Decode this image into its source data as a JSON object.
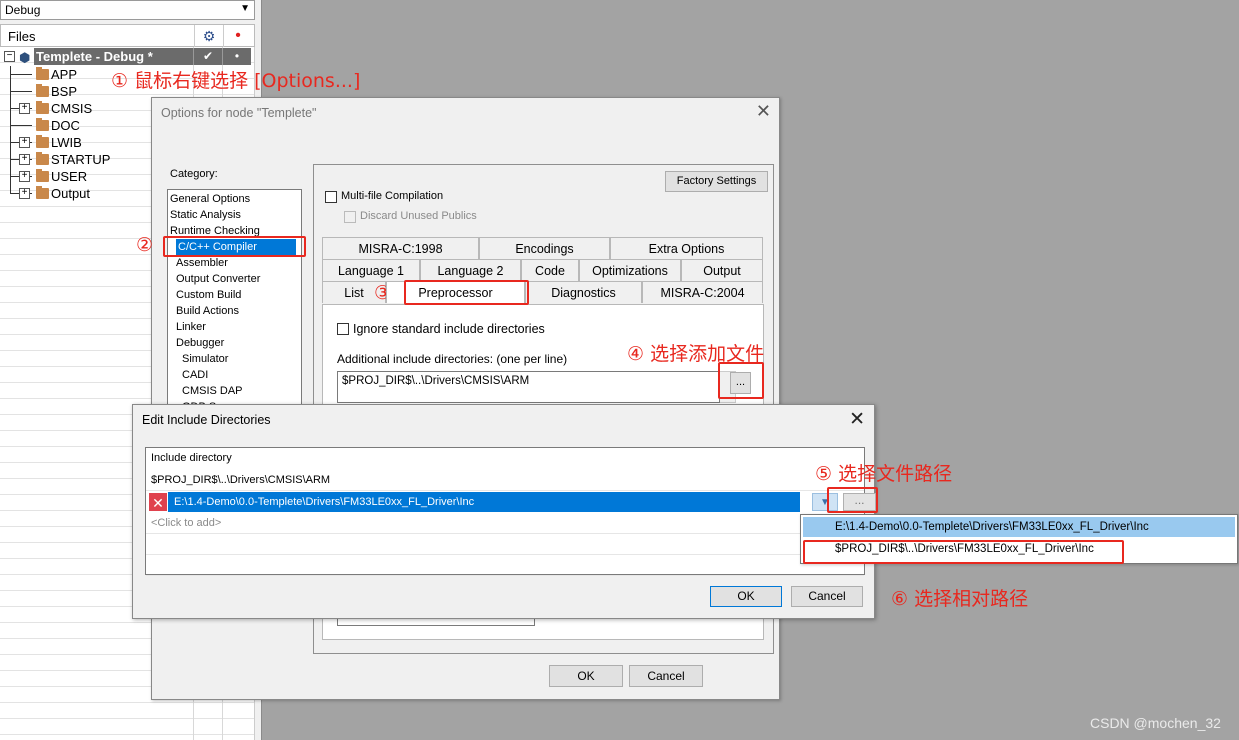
{
  "workspace": {
    "config": "Debug",
    "files_label": "Files",
    "root": "Templete - Debug *",
    "root_check": "✔",
    "root_dot": "•",
    "items": [
      {
        "label": "APP",
        "expandable": false
      },
      {
        "label": "BSP",
        "expandable": false
      },
      {
        "label": "CMSIS",
        "expandable": true
      },
      {
        "label": "DOC",
        "expandable": false
      },
      {
        "label": "LWIB",
        "expandable": true
      },
      {
        "label": "STARTUP",
        "expandable": true
      },
      {
        "label": "USER",
        "expandable": true
      },
      {
        "label": "Output",
        "expandable": true
      }
    ],
    "expand_glyph": "+",
    "collapse_glyph": "−"
  },
  "annotations": {
    "a1": "① 鼠标右键选择 [Options...]",
    "a2": "②",
    "a3": "③",
    "a4": "④ 选择添加文件",
    "a5": "⑤ 选择文件路径",
    "a6": "⑥ 选择相对路径"
  },
  "options_dialog": {
    "title": "Options for node \"Templete\"",
    "close": "✕",
    "category_label": "Category:",
    "categories": [
      "General Options",
      "Static Analysis",
      "Runtime Checking",
      "C/C++ Compiler",
      "Assembler",
      "Output Converter",
      "Custom Build",
      "Build Actions",
      "Linker",
      "Debugger",
      "Simulator",
      "CADI",
      "CMSIS DAP",
      "GDB Server"
    ],
    "selected_category": "C/C++ Compiler",
    "factory_settings": "Factory Settings",
    "multi_file": "Multi-file Compilation",
    "discard_unused": "Discard Unused Publics",
    "tabs_row1": [
      "MISRA-C:1998",
      "Encodings",
      "Extra Options"
    ],
    "tabs_row2": [
      "Language 1",
      "Language 2",
      "Code",
      "Optimizations",
      "Output"
    ],
    "tabs_row3": [
      "List",
      "Preprocessor",
      "Diagnostics",
      "MISRA-C:2004"
    ],
    "active_tab": "Preprocessor",
    "ignore_std": "Ignore standard include directories",
    "additional_label": "Additional include directories: (one per line)",
    "include_value": "$PROJ_DIR$\\..\\Drivers\\CMSIS\\ARM",
    "dots": "...",
    "ok": "OK",
    "cancel": "Cancel"
  },
  "edit_dialog": {
    "title": "Edit Include Directories",
    "close": "✕",
    "header": "Include directory",
    "row1": "$PROJ_DIR$\\..\\Drivers\\CMSIS\\ARM",
    "row2": "E:\\1.4-Demo\\0.0-Templete\\Drivers\\FM33LE0xx_FL_Driver\\Inc",
    "click_to_add": "<Click to add>",
    "delete_glyph": "✕",
    "ok": "OK",
    "cancel": "Cancel",
    "browse": "...",
    "combo_arrow": "▼"
  },
  "dropdown": {
    "items": [
      "E:\\1.4-Demo\\0.0-Templete\\Drivers\\FM33LE0xx_FL_Driver\\Inc",
      "$PROJ_DIR$\\..\\Drivers\\FM33LE0xx_FL_Driver\\Inc"
    ]
  },
  "watermark": "CSDN @mochen_32",
  "colors": {
    "accent": "#0078d7",
    "annotation": "#e8281f"
  }
}
